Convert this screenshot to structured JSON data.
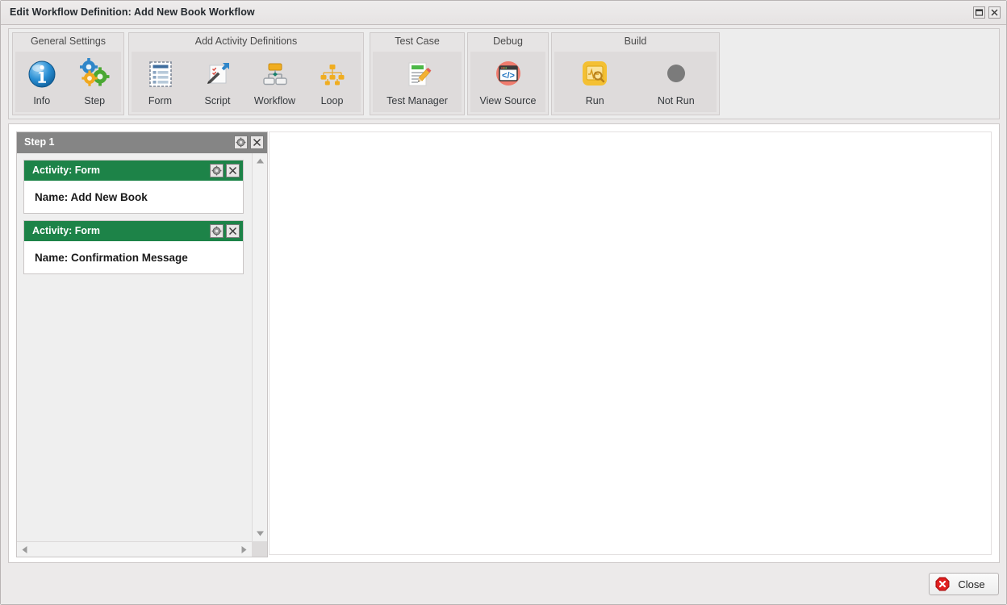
{
  "window": {
    "title": "Edit Workflow Definition: Add New Book Workflow",
    "restore_icon": "restore-icon",
    "close_icon": "close-icon"
  },
  "ribbon": {
    "groups": [
      {
        "id": "general",
        "title": "General Settings",
        "items": [
          {
            "label": "Info",
            "icon": "info-icon"
          },
          {
            "label": "Step",
            "icon": "gears-icon"
          }
        ]
      },
      {
        "id": "activity",
        "title": "Add Activity Definitions",
        "items": [
          {
            "label": "Form",
            "icon": "form-icon"
          },
          {
            "label": "Script",
            "icon": "script-icon"
          },
          {
            "label": "Workflow",
            "icon": "workflow-icon"
          },
          {
            "label": "Loop",
            "icon": "loop-icon"
          }
        ]
      },
      {
        "id": "testcase",
        "title": "Test Case",
        "items": [
          {
            "label": "Test Manager",
            "icon": "test-manager-icon"
          }
        ]
      },
      {
        "id": "debug",
        "title": "Debug",
        "items": [
          {
            "label": "View Source",
            "icon": "view-source-icon"
          }
        ]
      },
      {
        "id": "build",
        "title": "Build",
        "items": [
          {
            "label": "Run",
            "icon": "run-icon"
          },
          {
            "label": "Not Run",
            "icon": "not-run-icon"
          }
        ]
      }
    ]
  },
  "step_panel": {
    "title": "Step 1",
    "settings_icon": "gear-icon",
    "remove_icon": "close-icon",
    "activities": [
      {
        "header": "Activity: Form",
        "name": "Name: Add New Book",
        "settings_icon": "gear-icon",
        "remove_icon": "close-icon"
      },
      {
        "header": "Activity: Form",
        "name": "Name: Confirmation Message",
        "settings_icon": "gear-icon",
        "remove_icon": "close-icon"
      }
    ]
  },
  "scrollbars": {
    "up_icon": "caret-up-icon",
    "down_icon": "caret-down-icon",
    "left_icon": "caret-left-icon",
    "right_icon": "caret-right-icon"
  },
  "footer": {
    "close_label": "Close",
    "close_icon": "error-close-icon"
  },
  "colors": {
    "activity_green": "#1d8348",
    "step_gray": "#858585",
    "window_bg": "#eceaea",
    "ribbon_bg": "#ededed",
    "accent_orange": "#f0ad20",
    "accent_blue": "#1a7fc1",
    "error_red": "#e02020"
  }
}
